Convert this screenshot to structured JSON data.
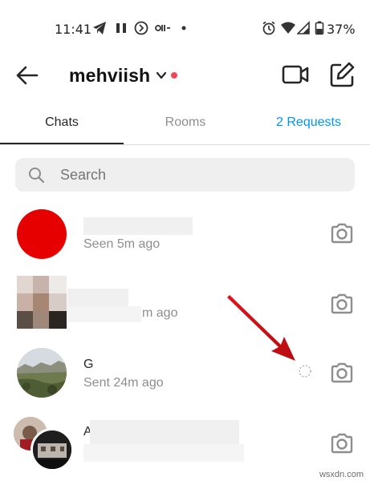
{
  "status_bar": {
    "time": "11:41",
    "battery": "37%",
    "icons": [
      "telegram-icon",
      "pause-icon",
      "shazam-icon",
      "carrier-icon",
      "dot-icon",
      "alarm-icon",
      "wifi-icon",
      "signal-icon",
      "battery-icon"
    ]
  },
  "header": {
    "username": "mehviish",
    "icons": [
      "back-arrow-icon",
      "chevron-down-icon",
      "video-call-icon",
      "compose-icon"
    ],
    "status_dot_color": "#ed4956"
  },
  "tabs": [
    {
      "label": "Chats",
      "active": true
    },
    {
      "label": "Rooms",
      "active": false
    },
    {
      "label": "2 Requests",
      "active": false
    }
  ],
  "search": {
    "placeholder": "Search"
  },
  "chats": [
    {
      "name": "",
      "subtitle": "Seen 5m ago",
      "avatar": "red-circle"
    },
    {
      "name": "",
      "subtitle": "m ago",
      "avatar": "pixelated"
    },
    {
      "name": "G",
      "subtitle": "Sent 24m ago",
      "avatar": "landscape"
    },
    {
      "name": "A",
      "subtitle": "",
      "avatar": "group"
    }
  ],
  "accent_color": "#0095f6",
  "watermark": "wsxdn.com"
}
